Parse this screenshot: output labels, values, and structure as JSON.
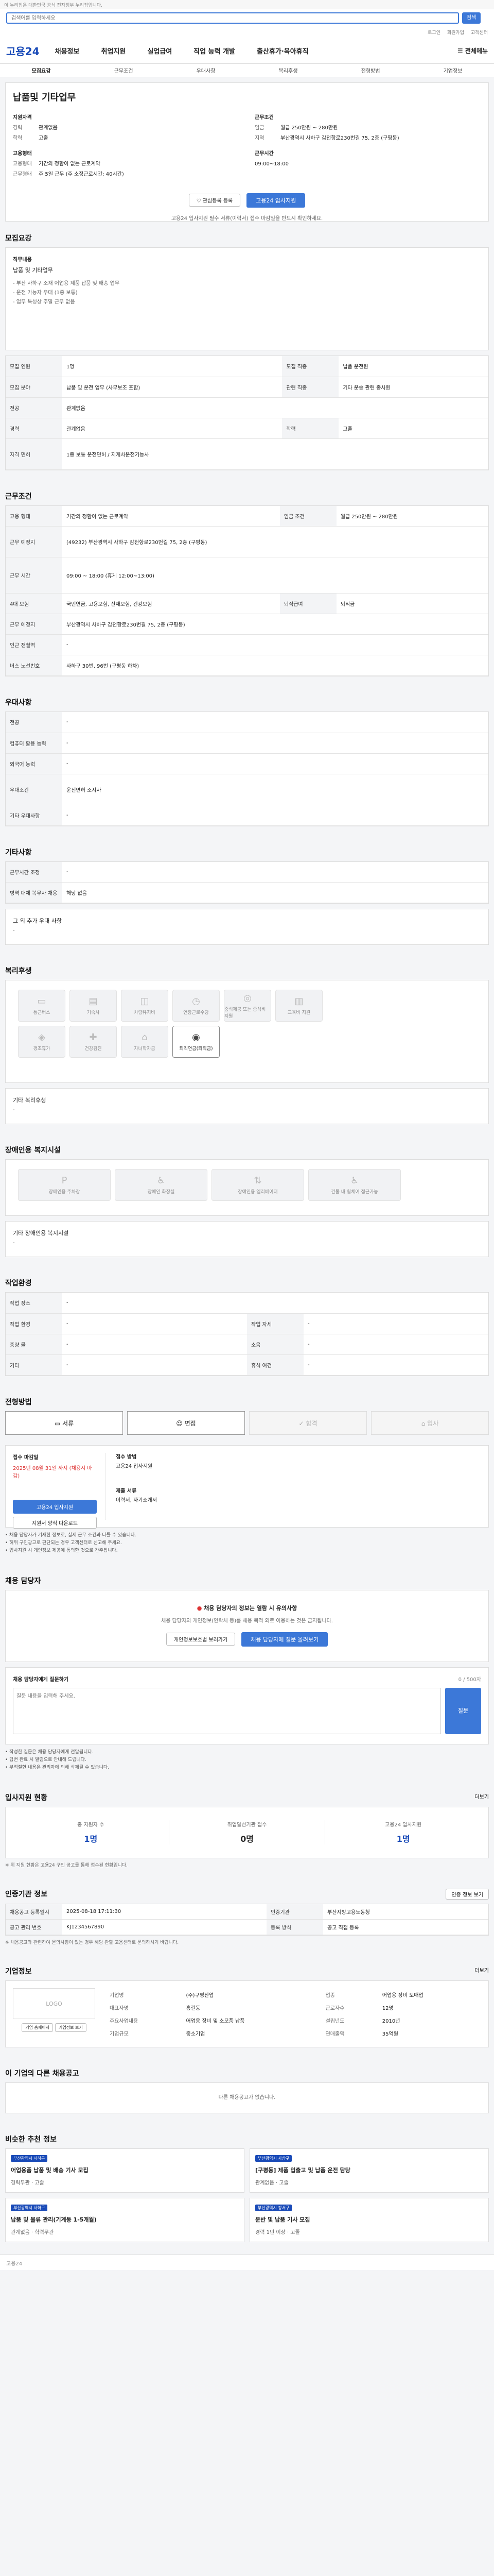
{
  "gov_banner": "이 누리집은 대한민국 공식 전자정부 누리집입니다.",
  "search": {
    "placeholder": "검색어를 입력하세요",
    "button": "검색"
  },
  "util": [
    "로그인",
    "회원가입",
    "고객센터"
  ],
  "logo": "고용24",
  "nav": [
    "채용정보",
    "취업지원",
    "실업급여",
    "직업 능력 개발",
    "출산휴가·육아휴직"
  ],
  "nav_right": "전체메뉴",
  "tabs": [
    "모집요강",
    "근무조건",
    "우대사항",
    "복리후생",
    "전형방법",
    "기업정보"
  ],
  "job": {
    "title": "납품및 기타업무",
    "left_head": "지원자격",
    "exp_k": "경력",
    "exp_v": "관계없음",
    "edu_k": "학력",
    "edu_v": "고졸",
    "emp_head": "고용형태",
    "emp_k1": "고용형태",
    "emp_v1": "기간의 정함이 없는 근로계약",
    "emp_k2": "근무형태",
    "emp_v2": "주 5일 근무 (주 소정근로시간: 40시간)",
    "right_head": "근무조건",
    "pay_k": "임금",
    "pay_v": "월급 250만원 ~ 280만원",
    "loc_k": "지역",
    "loc_v": "부산광역시 사하구 감천항로230번길 75, 2층 (구평동)",
    "wt_head": "근무시간",
    "wt_v": "09:00~18:00"
  },
  "actions": {
    "like": "관심등록 등록",
    "apply": "고용24 입사지원"
  },
  "notice_top": "고용24 입사지원 필수 서류(이력서) 접수 마감일을 반드시 확인하세요.",
  "s1": {
    "title": "모집요강",
    "duty_k": "직무내용",
    "duty_head": "납품 및 기타업무",
    "duty_lines": [
      "- 부산 사하구 소재 어업용 제품 납품 및 배송 업무",
      "- 운전 가능자 우대 (1종 보통)",
      "- 업무 특성상 주말 근무 없음"
    ]
  },
  "s1_rows": [
    [
      "모집 인원",
      "1명",
      "모집 직종",
      "납품 운전원"
    ],
    [
      "모집 분야",
      "납품 및 운전 업무 (사무보조 포함)",
      "관련 직종",
      "기타 운송 관련 종사원"
    ],
    [
      "전공",
      "관계없음",
      "",
      ""
    ],
    [
      "경력",
      "관계없음",
      "학력",
      "고졸"
    ],
    [
      "자격 면허",
      "1종 보통 운전면허 / 지게차운전기능사",
      "",
      ""
    ]
  ],
  "s2": {
    "title": "근무조건",
    "rows": [
      [
        "고용 형태",
        "기간의 정함이 없는 근로계약",
        "임금 조건",
        "월급 250만원 ~ 280만원"
      ],
      [
        "근무 예정지",
        "(49232) 부산광역시 사하구 감천항로230번길 75, 2층 (구평동)",
        "",
        ""
      ],
      [
        "근무 시간",
        "09:00 ~ 18:00 (휴게 12:00~13:00)",
        "",
        ""
      ],
      [
        "4대 보험",
        "국민연금, 고용보험, 산재보험, 건강보험",
        "퇴직급여",
        "퇴직금"
      ],
      [
        "근무 예정지",
        "부산광역시 사하구 감천항로230번길 75, 2층 (구평동)",
        "",
        ""
      ],
      [
        "인근 전철역",
        "-",
        "",
        ""
      ],
      [
        "버스 노선번호",
        "사하구 30번, 96번 (구평동 하차)",
        "",
        ""
      ]
    ]
  },
  "s3": {
    "title": "우대사항",
    "rows": [
      [
        "전공",
        "-"
      ],
      [
        "컴퓨터 활용 능력",
        "-"
      ],
      [
        "외국어 능력",
        "-"
      ],
      [
        "우대조건",
        "운전면허 소지자"
      ],
      [
        "기타 우대사항",
        "-"
      ]
    ]
  },
  "s4": {
    "title": "기타사항",
    "rows": [
      [
        "근무시간 조정",
        "-"
      ],
      [
        "병역 대체 복무자 채용",
        "해당 없음"
      ]
    ],
    "etc_k": "그 외 추가 우대 사항",
    "etc_v": "-"
  },
  "s5": {
    "title": "복리후생",
    "items": [
      "통근버스",
      "기숙사",
      "차량유지비",
      "연장근로수당",
      "중식제공 또는 중식비 지원",
      "교육비 지원",
      "경조휴가",
      "건강검진",
      "자녀학자금",
      "퇴직연금(퇴직금)"
    ],
    "etc_k": "기타 복리후생",
    "etc_v": "-"
  },
  "s6": {
    "title": "장애인용 복지시설",
    "items": [
      "장애인용 주차장",
      "장애인 화장실",
      "장애인용 엘리베이터",
      "건물 내 휠체어 접근가능"
    ],
    "etc_k": "기타 장애인용 복지시설",
    "etc_v": "-"
  },
  "s7": {
    "title": "작업환경",
    "rows": [
      [
        "작업 장소",
        "-",
        "",
        ""
      ],
      [
        "작업 환경",
        "-",
        "작업 자세",
        "-"
      ],
      [
        "중량 물",
        "-",
        "소음",
        "-"
      ],
      [
        "기타",
        "-",
        "휴식 여건",
        "-"
      ]
    ]
  },
  "s8": {
    "title": "전형방법",
    "steps": [
      "서류",
      "면접",
      "합격",
      "입사"
    ],
    "doc_head": "접수 마감일",
    "doc_date": "2025년 08월 31일 까지 (채용시 마감)",
    "method_head": "접수 방법",
    "method_v": "고용24 입사지원",
    "apply_btn": "고용24 입사지원",
    "sample_btn": "지원서 양식 다운로드",
    "form_head": "제출 서류",
    "form_v": "이력서, 자기소개서"
  },
  "warn_lines": [
    "• 채용 담당자가 기재한 정보로, 실제 근무 조건과 다를 수 있습니다.",
    "• 허위 구인광고로 판단되는 경우 고객센터로 신고해 주세요.",
    "• 입사지원 시 개인정보 제공에 동의한 것으로 간주됩니다."
  ],
  "s9": {
    "title": "채용 담당자",
    "alert": "채용 담당자의 정보는 열람 시 유의사항",
    "desc": "채용 담당자의 개인정보(연락처 등)를 채용 목적 외로 이용하는 것은 금지됩니다.",
    "b1": "개인정보보호법 보러가기",
    "b2": "채용 담당자에 질문 올려보기"
  },
  "qa": {
    "head": "채용 담당자에게 질문하기",
    "cnt": "0 / 500자",
    "placeholder": "질문 내용을 입력해 주세요.",
    "btn": "질문"
  },
  "qa_notes": [
    "• 작성한 질문은 채용 담당자에게 전달됩니다.",
    "• 답변 완료 시 알림으로 안내해 드립니다.",
    "• 부적절한 내용은 관리자에 의해 삭제될 수 있습니다."
  ],
  "s10": {
    "title": "입사지원 현황",
    "more": "더보기",
    "cards": [
      [
        "총 지원자 수",
        "1명"
      ],
      [
        "취업알선기관 접수",
        "0명"
      ],
      [
        "고용24 입사지원",
        "1명"
      ]
    ],
    "note": "※ 위 지원 현황은 고용24 구인 공고를 통해 접수된 현황입니다."
  },
  "s11": {
    "title": "인증기관 정보",
    "btn": "인증 정보 보기",
    "rows": [
      [
        "채용공고 등록일시",
        "2025-08-18 17:11:30",
        "인증기관",
        "부산지방고용노동청"
      ],
      [
        "공고 관리 번호",
        "KJ1234567890",
        "등록 방식",
        "공고 직접 등록"
      ]
    ],
    "note": "※ 채용공고와 관련하여 문의사항이 있는 경우 해당 관할 고용센터로 문의하시기 바랍니다."
  },
  "s12": {
    "title": "기업정보",
    "more": "더보기",
    "logo_txt": "LOGO",
    "btn1": "기업 홈페이지",
    "btn2": "기업정보 보기",
    "rows": [
      [
        "기업명",
        "(주)구평산업",
        "업종",
        "어업용 장비 도매업"
      ],
      [
        "대표자명",
        "홍길동",
        "근로자수",
        "12명"
      ],
      [
        "주요사업내용",
        "어업용 장비 및 소모품 납품",
        "설립년도",
        "2010년"
      ],
      [
        "기업규모",
        "중소기업",
        "연매출액",
        "35억원"
      ]
    ]
  },
  "s13": {
    "title": "이 기업의 다른 채용공고",
    "empty": "다른 채용공고가 없습니다."
  },
  "s14": {
    "title": "비슷한 추천 정보",
    "jobs": [
      [
        "부산광역시 사하구",
        "어업용품 납품 및 배송 기사 모집",
        "경력무관",
        "고졸"
      ],
      [
        "부산광역시 사상구",
        "[구평동] 제품 입출고 및 납품 운전 담당",
        "관계없음",
        "고졸"
      ],
      [
        "부산광역시 사하구",
        "납품 및 물류 관리(기계동 1-5개월)",
        "관계없음",
        "학력무관"
      ],
      [
        "부산광역시 강서구",
        "운반 및 납품 기사 모집",
        "경력 1년 이상",
        "고졸"
      ]
    ]
  },
  "footer": "고용24"
}
